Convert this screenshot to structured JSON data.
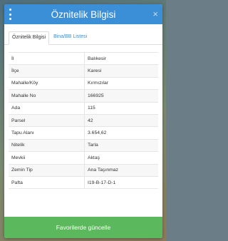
{
  "dialog": {
    "title": "Öznitelik Bilgisi",
    "close_symbol": "×"
  },
  "tabs": [
    {
      "label": "Öznitelik Bilgisi",
      "active": true
    },
    {
      "label": "Bina/BB Listesi",
      "active": false
    }
  ],
  "attributes": [
    {
      "label": "İl",
      "value": "Balıkesir"
    },
    {
      "label": "İlçe",
      "value": "Karesi"
    },
    {
      "label": "Mahalle/Köy",
      "value": "Kırmızılar"
    },
    {
      "label": "Mahalle No",
      "value": "166925"
    },
    {
      "label": "Ada",
      "value": "115"
    },
    {
      "label": "Parsel",
      "value": "42"
    },
    {
      "label": "Tapu Alanı",
      "value": "3.654,62"
    },
    {
      "label": "Nitelik",
      "value": "Tarla"
    },
    {
      "label": "Mevkii",
      "value": "Aktaş"
    },
    {
      "label": "Zemin Tip",
      "value": "Ana Taşınmaz"
    },
    {
      "label": "Pafta",
      "value": "I19-B-17-D-1"
    }
  ],
  "footer": {
    "button_label": "Favorilerde güncelle"
  },
  "colors": {
    "header": "#3a8fd6",
    "button": "#5cb85c",
    "tab_link": "#3a8fd6"
  }
}
